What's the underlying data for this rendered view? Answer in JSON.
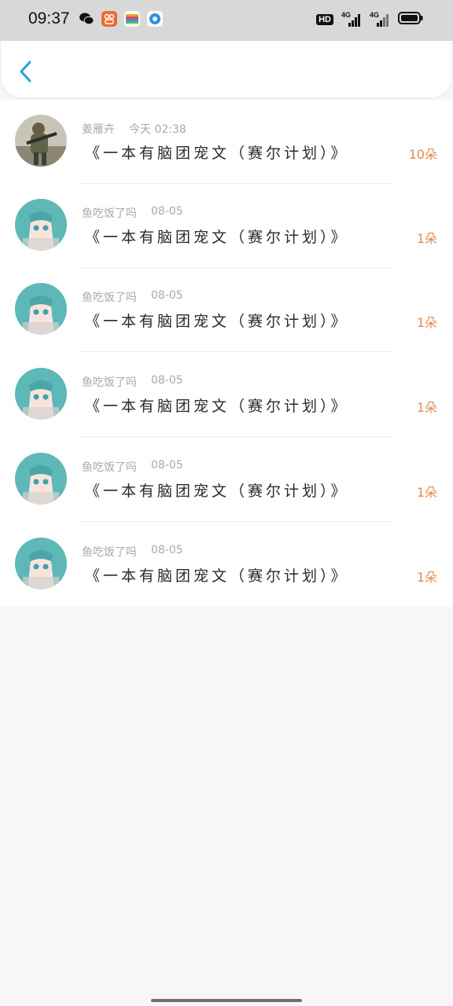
{
  "status_bar": {
    "time": "09:37",
    "app_icons": [
      "wechat-icon",
      "kuaishou-icon",
      "wallet-icon",
      "browser-icon"
    ],
    "right_icons": [
      "hd-icon",
      "4g-signal-icon",
      "4g-signal-icon",
      "battery-icon"
    ],
    "hd_label": "HD",
    "net_label_1": "4G",
    "net_label_2": "4G"
  },
  "header": {
    "back_icon": "chevron-left-icon",
    "accent_color": "#2d9fd8"
  },
  "rows": [
    {
      "user": "姜雁卉",
      "time": "今天 02:38",
      "title": "《一本有脑团宠文（赛尔计划）》",
      "count": "10朵",
      "avatar": "soldier"
    },
    {
      "user": "鱼吃饭了吗",
      "time": "08-05",
      "title": "《一本有脑团宠文（赛尔计划）》",
      "count": "1朵",
      "avatar": "anime"
    },
    {
      "user": "鱼吃饭了吗",
      "time": "08-05",
      "title": "《一本有脑团宠文（赛尔计划）》",
      "count": "1朵",
      "avatar": "anime"
    },
    {
      "user": "鱼吃饭了吗",
      "time": "08-05",
      "title": "《一本有脑团宠文（赛尔计划）》",
      "count": "1朵",
      "avatar": "anime"
    },
    {
      "user": "鱼吃饭了吗",
      "time": "08-05",
      "title": "《一本有脑团宠文（赛尔计划）》",
      "count": "1朵",
      "avatar": "anime"
    },
    {
      "user": "鱼吃饭了吗",
      "time": "08-05",
      "title": "《一本有脑团宠文（赛尔计划）》",
      "count": "1朵",
      "avatar": "anime"
    }
  ],
  "colors": {
    "count": "#e38a4e",
    "meta": "#a9a9a9",
    "title": "#2a2a2a"
  }
}
